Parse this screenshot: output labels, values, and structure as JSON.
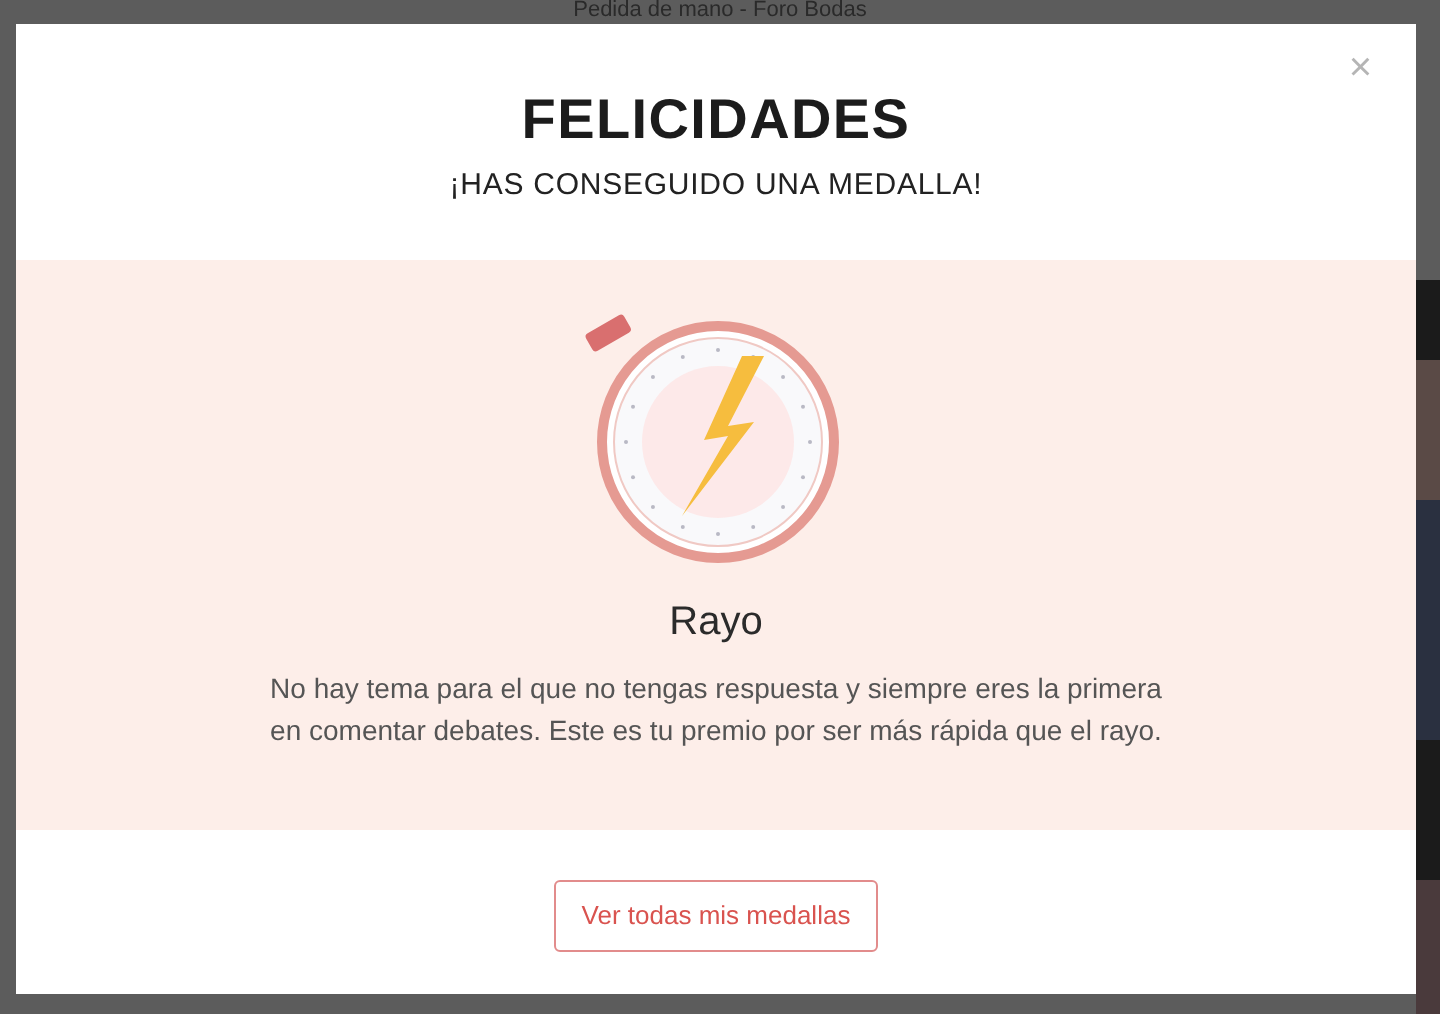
{
  "background": {
    "title": "Pedida de mano - Foro Bodas"
  },
  "modal": {
    "title": "FELICIDADES",
    "subtitle": "¡HAS CONSEGUIDO UNA MEDALLA!",
    "close": "×",
    "medal": {
      "name": "Rayo",
      "description": "No hay tema para el que no tengas respuesta y siempre eres la primera en comentar debates. Este es tu premio por ser más rápida que el rayo."
    },
    "button": "Ver todas mis medallas"
  }
}
